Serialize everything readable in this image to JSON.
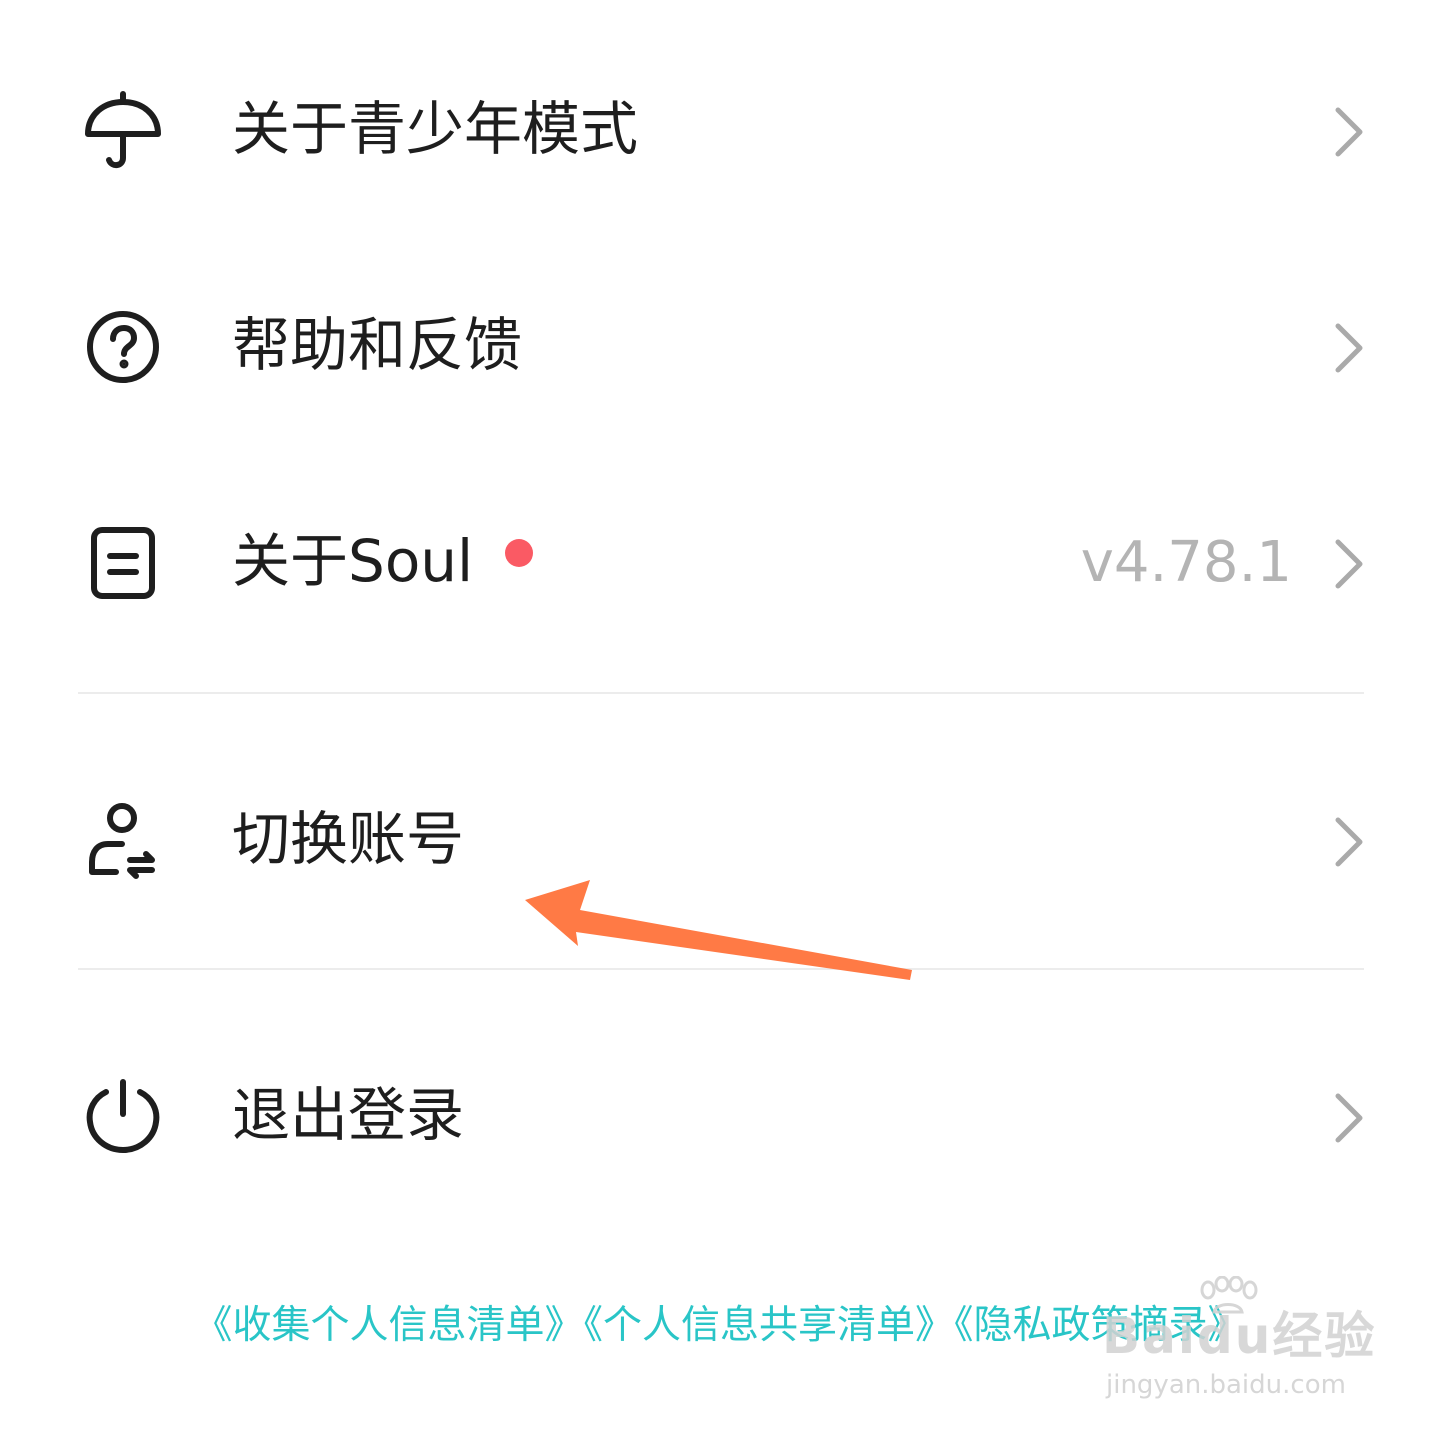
{
  "settings": {
    "items": [
      {
        "label": "关于青少年模式",
        "icon": "umbrella-icon"
      },
      {
        "label": "帮助和反馈",
        "icon": "help-circle-icon"
      },
      {
        "label": "关于Soul",
        "icon": "document-icon",
        "badge": "red-dot",
        "value": "v4.78.1"
      },
      {
        "label": "切换账号",
        "icon": "switch-account-icon"
      },
      {
        "label": "退出登录",
        "icon": "power-icon"
      }
    ]
  },
  "footer": {
    "links": [
      "《收集个人信息清单》",
      "《个人信息共享清单》",
      "《隐私政策摘录》"
    ]
  },
  "annotation": {
    "arrow_color": "#ff7a45",
    "points_to": "切换账号"
  },
  "watermark": {
    "brand": "Baidu经验",
    "url": "jingyan.baidu.com"
  },
  "colors": {
    "text": "#1e1e1e",
    "muted": "#b4b4b4",
    "badge": "#fa5a64",
    "link": "#29c5c7",
    "divider": "#ececec"
  }
}
